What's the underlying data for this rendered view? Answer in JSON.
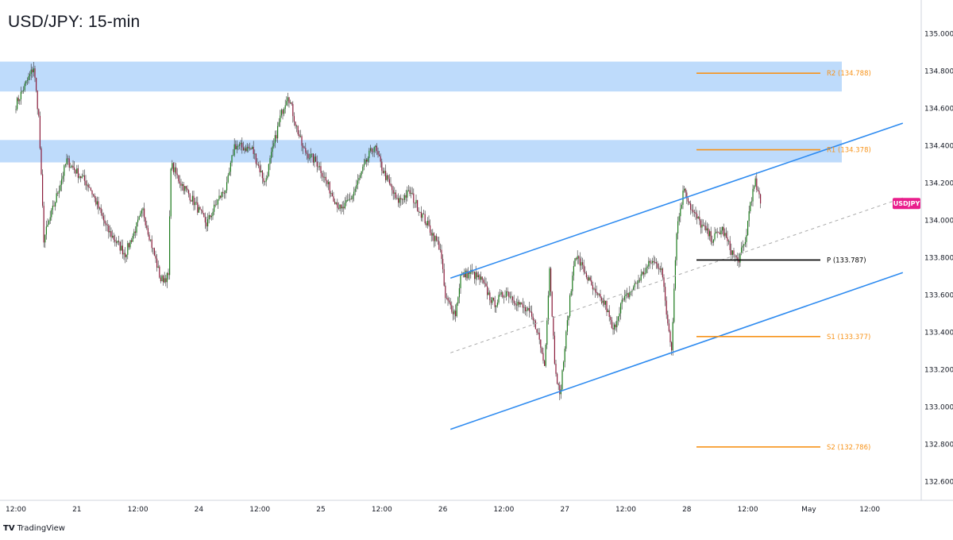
{
  "chart_data": {
    "type": "candlestick",
    "title": "USD/JPY: 15-min",
    "symbol_badge": "USDJPY",
    "ylim": [
      132.5,
      135.18
    ],
    "y_ticks": [
      "135.000",
      "134.800",
      "134.600",
      "134.400",
      "134.200",
      "134.000",
      "133.800",
      "133.600",
      "133.400",
      "133.200",
      "133.000",
      "132.800",
      "132.600"
    ],
    "y_tick_values": [
      135.0,
      134.8,
      134.6,
      134.4,
      134.2,
      134.0,
      133.8,
      133.6,
      133.4,
      133.2,
      133.0,
      132.8,
      132.6
    ],
    "x_ticks": [
      "12:00",
      "21",
      "12:00",
      "24",
      "12:00",
      "25",
      "12:00",
      "26",
      "12:00",
      "27",
      "12:00",
      "28",
      "12:00",
      "May",
      "12:00"
    ],
    "x_tick_index": [
      0,
      48,
      96,
      144,
      192,
      240,
      288,
      336,
      384,
      432,
      480,
      528,
      576,
      624,
      672
    ],
    "last_price": 134.09,
    "pivot_levels": [
      {
        "label": "R2 (134.788)",
        "value": 134.788,
        "color": "#f7931a"
      },
      {
        "label": "R1 (134.378)",
        "value": 134.378,
        "color": "#f7931a"
      },
      {
        "label": "P (133.787)",
        "value": 133.787,
        "color": "#000000"
      },
      {
        "label": "S1 (133.377)",
        "value": 133.377,
        "color": "#f7931a"
      },
      {
        "label": "S2 (132.786)",
        "value": 132.786,
        "color": "#f7931a"
      }
    ],
    "zones": [
      {
        "from": 134.69,
        "to": 134.85
      },
      {
        "from": 134.31,
        "to": 134.43
      }
    ],
    "channel": {
      "upper": {
        "i0": 342,
        "y0": 133.69,
        "i1": 698,
        "y1": 134.52
      },
      "lower": {
        "i0": 342,
        "y0": 132.88,
        "i1": 698,
        "y1": 133.72
      },
      "mid": {
        "i0": 342,
        "y0": 133.29,
        "i1": 698,
        "y1": 134.12
      }
    },
    "path": [
      [
        0,
        134.62
      ],
      [
        14,
        134.82
      ],
      [
        18,
        134.55
      ],
      [
        22,
        133.9
      ],
      [
        30,
        134.08
      ],
      [
        40,
        134.32
      ],
      [
        58,
        134.18
      ],
      [
        72,
        133.95
      ],
      [
        86,
        133.82
      ],
      [
        100,
        134.05
      ],
      [
        114,
        133.68
      ],
      [
        120,
        133.7
      ],
      [
        122,
        134.3
      ],
      [
        128,
        134.22
      ],
      [
        140,
        134.1
      ],
      [
        150,
        133.98
      ],
      [
        160,
        134.12
      ],
      [
        166,
        134.18
      ],
      [
        172,
        134.4
      ],
      [
        186,
        134.38
      ],
      [
        196,
        134.2
      ],
      [
        208,
        134.55
      ],
      [
        214,
        134.68
      ],
      [
        220,
        134.52
      ],
      [
        226,
        134.38
      ],
      [
        238,
        134.3
      ],
      [
        248,
        134.15
      ],
      [
        256,
        134.05
      ],
      [
        264,
        134.12
      ],
      [
        278,
        134.35
      ],
      [
        282,
        134.4
      ],
      [
        288,
        134.28
      ],
      [
        300,
        134.1
      ],
      [
        310,
        134.15
      ],
      [
        318,
        134.05
      ],
      [
        326,
        133.95
      ],
      [
        334,
        133.85
      ],
      [
        338,
        133.58
      ],
      [
        346,
        133.5
      ],
      [
        350,
        133.7
      ],
      [
        358,
        133.72
      ],
      [
        366,
        133.68
      ],
      [
        376,
        133.55
      ],
      [
        386,
        133.62
      ],
      [
        396,
        133.55
      ],
      [
        404,
        133.5
      ],
      [
        410,
        133.42
      ],
      [
        416,
        133.22
      ],
      [
        420,
        133.75
      ],
      [
        424,
        133.25
      ],
      [
        428,
        133.05
      ],
      [
        434,
        133.45
      ],
      [
        440,
        133.82
      ],
      [
        448,
        133.72
      ],
      [
        456,
        133.6
      ],
      [
        464,
        133.55
      ],
      [
        470,
        133.4
      ],
      [
        476,
        133.55
      ],
      [
        484,
        133.62
      ],
      [
        492,
        133.7
      ],
      [
        500,
        133.78
      ],
      [
        508,
        133.75
      ],
      [
        512,
        133.5
      ],
      [
        516,
        133.32
      ],
      [
        520,
        133.95
      ],
      [
        526,
        134.18
      ],
      [
        532,
        134.05
      ],
      [
        542,
        133.95
      ],
      [
        548,
        133.9
      ],
      [
        556,
        133.95
      ],
      [
        562,
        133.85
      ],
      [
        568,
        133.78
      ],
      [
        574,
        133.88
      ],
      [
        578,
        134.1
      ],
      [
        582,
        134.2
      ],
      [
        586,
        134.09
      ]
    ]
  }
}
